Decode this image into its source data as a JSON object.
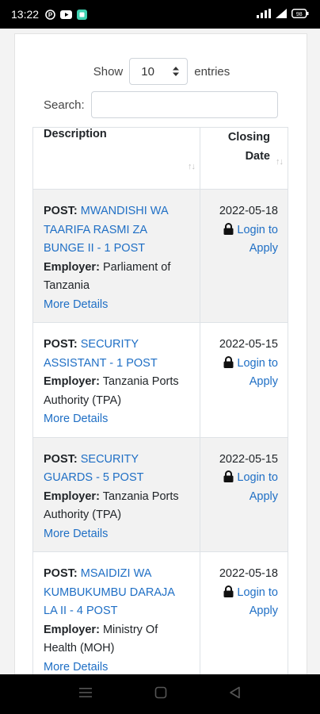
{
  "status_bar": {
    "time": "13:22",
    "battery": "98"
  },
  "length_control": {
    "show_label": "Show",
    "value": "10",
    "entries_label": "entries"
  },
  "search": {
    "label": "Search:",
    "value": ""
  },
  "table": {
    "headers": {
      "description": "Description",
      "closing_date_line1": "Closing",
      "closing_date_line2": "Date"
    },
    "post_label": "POST:",
    "employer_label": "Employer:",
    "more_details_label": "More Details",
    "login_label": "Login to",
    "apply_label": "Apply",
    "rows": [
      {
        "post_line1": "MWANDISHI WA",
        "post_line2": "TAARIFA RASMI ZA",
        "post_line3": "BUNGE II - 1 POST",
        "employer_line1": "Parliament of",
        "employer_line2": "Tanzania",
        "closing_date": "2022-05-18"
      },
      {
        "post_line1": "SECURITY",
        "post_line2": "ASSISTANT - 1 POST",
        "employer_line1": "Tanzania Ports",
        "employer_line2": "Authority (TPA)",
        "closing_date": "2022-05-15"
      },
      {
        "post_line1": "SECURITY",
        "post_line2": "GUARDS - 5 POST",
        "employer_line1": "Tanzania Ports",
        "employer_line2": "Authority (TPA)",
        "closing_date": "2022-05-15"
      },
      {
        "post_line1": "MSAIDIZI WA",
        "post_line2": "KUMBUKUMBU DARAJA",
        "post_line3": "LA II - 4 POST",
        "employer_line1": "Ministry Of",
        "employer_line2": "Health (MOH)",
        "closing_date": "2022-05-18"
      }
    ]
  },
  "icons": {
    "lock": "lock-icon",
    "sort": "sort-icon",
    "nav_menu": "menu-icon",
    "nav_home": "home-icon",
    "nav_back": "back-icon"
  },
  "colors": {
    "link": "#1f6fc5",
    "stripe": "#f2f2f2"
  }
}
